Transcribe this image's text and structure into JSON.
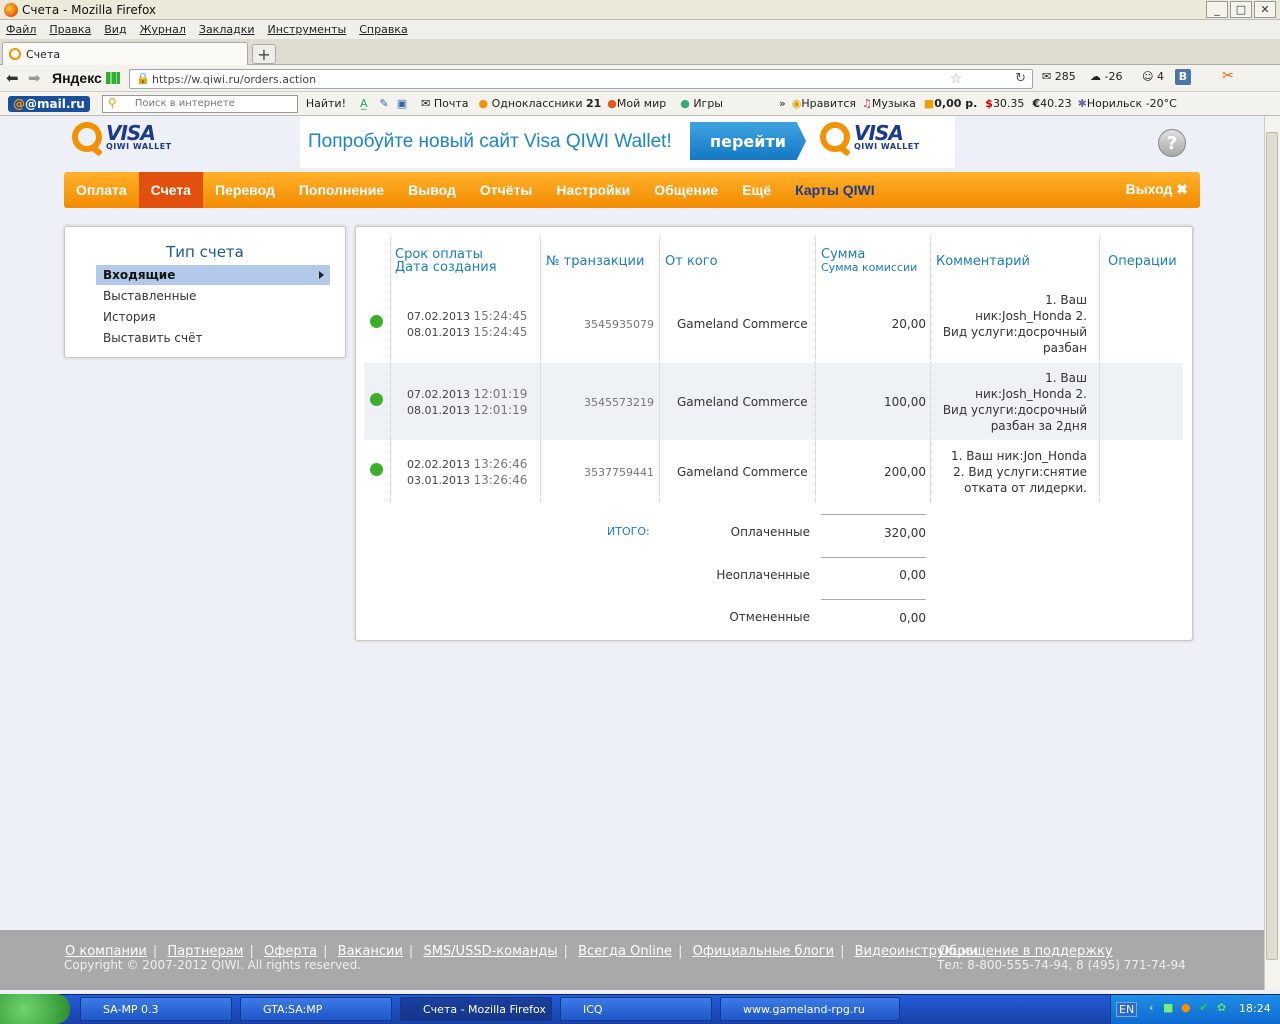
{
  "window": {
    "title": "Счета - Mozilla Firefox"
  },
  "menu": [
    "Файл",
    "Правка",
    "Вид",
    "Журнал",
    "Закладки",
    "Инструменты",
    "Справка"
  ],
  "tab": {
    "title": "Счета"
  },
  "address": {
    "url": "https://w.qiwi.ru/orders.action",
    "yandex": "Яндекс",
    "mail_count": "285",
    "weather": "-26",
    "badge": "4"
  },
  "toolbar2": {
    "mailru": "@mail.ru",
    "search_placeholder": "Поиск в интернете",
    "find": "Найти!",
    "items": [
      "Почта",
      "Одноклассники",
      "Мой мир",
      "Игры"
    ],
    "ok_count": "21",
    "right": [
      "Нравится",
      "Музыка",
      "0,00 р.",
      "30.35",
      "40.23",
      "Норильск -20°C"
    ]
  },
  "logo": {
    "visa": "VISA",
    "wallet": "QIWI WALLET"
  },
  "banner": {
    "text": "Попробуйте новый сайт Visa QIWI Wallet!",
    "button": "перейти"
  },
  "nav": {
    "items": [
      "Оплата",
      "Счета",
      "Перевод",
      "Пополнение",
      "Вывод",
      "Отчёты",
      "Настройки",
      "Общение",
      "Ещё"
    ],
    "cards": "Карты QIWI",
    "logout": "Выход"
  },
  "sidebar": {
    "title": "Тип счета",
    "items": [
      "Входящие",
      "Выставленные",
      "История",
      "Выставить счёт"
    ]
  },
  "table": {
    "headers": {
      "due": "Срок оплаты",
      "created": "Дата создания",
      "txn": "№ транзакции",
      "from": "От кого",
      "sum": "Сумма",
      "fee": "Сумма комиссии",
      "comment": "Комментарий",
      "ops": "Операции"
    },
    "rows": [
      {
        "due_date": "07.02.2013",
        "due_time": "15:24:45",
        "created_date": "08.01.2013",
        "created_time": "15:24:45",
        "txn": "3545935079",
        "from": "Gameland Commerce",
        "amount": "20,00",
        "comment": [
          "1. Ваш",
          "ник:Josh_Honda 2.",
          "Вид услуги:досрочный",
          "разбан"
        ]
      },
      {
        "due_date": "07.02.2013",
        "due_time": "12:01:19",
        "created_date": "08.01.2013",
        "created_time": "12:01:19",
        "txn": "3545573219",
        "from": "Gameland Commerce",
        "amount": "100,00",
        "comment": [
          "1. Ваш",
          "ник:Josh_Honda 2.",
          "Вид услуги:досрочный",
          "разбан за 2дня"
        ]
      },
      {
        "due_date": "02.02.2013",
        "due_time": "13:26:46",
        "created_date": "03.01.2013",
        "created_time": "13:26:46",
        "txn": "3537759441",
        "from": "Gameland Commerce",
        "amount": "200,00",
        "comment": [
          "1. Ваш ник:Jon_Honda",
          "2. Вид услуги:снятие",
          "отката от лидерки."
        ]
      }
    ]
  },
  "totals": {
    "label": "ИТОГО:",
    "paid_label": "Оплаченные",
    "paid": "320,00",
    "unpaid_label": "Неоплаченные",
    "unpaid": "0,00",
    "cancelled_label": "Отмененные",
    "cancelled": "0,00"
  },
  "footer": {
    "links": [
      "О компании",
      "Партнерам",
      "Оферта",
      "Вакансии",
      "SMS/USSD-команды",
      "Всегда Online",
      "Официальные блоги",
      "Видеоинструкции"
    ],
    "copyright": "Copyright © 2007-2012 QIWI. All rights reserved.",
    "support": "Обращение в поддержку",
    "phone": "Тел: 8-800-555-74-94, 8 (495) 771-74-94"
  },
  "taskbar": {
    "items": [
      "SA-MP 0.3",
      "GTA:SA:MP",
      "Счета - Mozilla Firefox",
      "ICQ",
      "www.gameland-rpg.ru"
    ],
    "lang": "EN",
    "time": "18:24"
  },
  "colors": {
    "accent_orange": "#f38b00",
    "active_tab": "#e2500e",
    "link_blue": "#1a7cc4",
    "status_green": "#3cae2a"
  }
}
